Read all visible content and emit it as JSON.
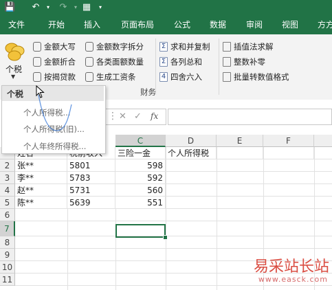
{
  "tabs": [
    "文件",
    "开始",
    "插入",
    "页面布局",
    "公式",
    "数据",
    "审阅",
    "视图",
    "方方"
  ],
  "ribbon": {
    "big_button": {
      "label": "个税",
      "icon": "coins-icon"
    },
    "items_col1": [
      "金额大写",
      "金额折合",
      "按揭贷款"
    ],
    "items_col2": [
      "金额数字拆分",
      "各类面额数量",
      "生成工资条"
    ],
    "items_col3": [
      "求和并复制",
      "各列总和",
      "四舍六入"
    ],
    "items_col4": [
      "插值法求解",
      "整数补零",
      "批量转数值格式"
    ],
    "group_label": "财务"
  },
  "dropdown": {
    "title": "个税",
    "items": [
      "个人所得税...",
      "个人所得税(旧)...",
      "个人年终所得税..."
    ]
  },
  "formula_bar": {
    "fx": "fx",
    "value": ""
  },
  "sheet": {
    "columns": [
      "C",
      "D",
      "E",
      "F"
    ],
    "selected_column": "C",
    "rows": [
      "2",
      "3",
      "4",
      "5",
      "6",
      "7",
      "8",
      "9",
      "10",
      "11"
    ],
    "selected_row": "7",
    "header_row": {
      "a": "姓名",
      "b": "税前收入",
      "c": "三险一金",
      "d": "个人所得税"
    },
    "data": [
      {
        "name": "张**",
        "income": "5801",
        "insurance": "598"
      },
      {
        "name": "李**",
        "income": "5783",
        "insurance": "592"
      },
      {
        "name": "赵**",
        "income": "5731",
        "insurance": "560"
      },
      {
        "name": "陈**",
        "income": "5639",
        "insurance": "551"
      }
    ]
  },
  "watermark": {
    "text": "易采站长站",
    "url": "www.easck.com"
  },
  "colors": {
    "accent": "#217346"
  }
}
